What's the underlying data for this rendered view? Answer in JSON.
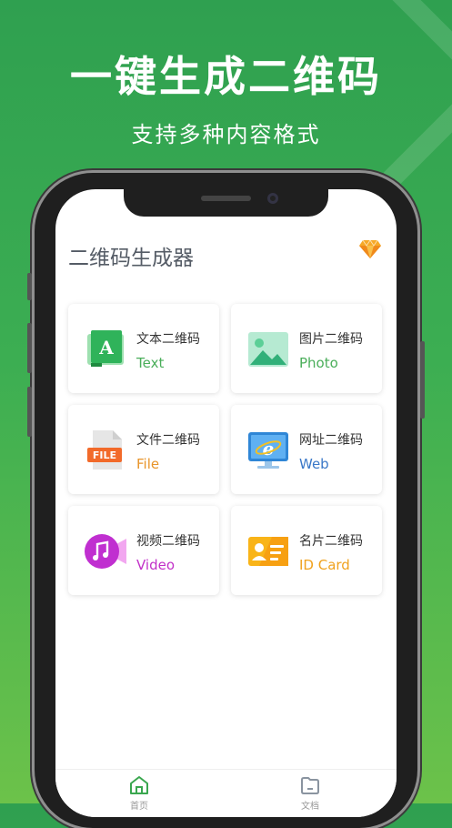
{
  "hero": {
    "title": "一键生成二维码",
    "subtitle": "支持多种内容格式"
  },
  "app": {
    "title": "二维码生成器",
    "vip_icon": "diamond-icon"
  },
  "cards": [
    {
      "name": "文本二维码",
      "en": "Text",
      "color": "#4aae5a",
      "icon": "text-book-icon"
    },
    {
      "name": "图片二维码",
      "en": "Photo",
      "color": "#4aae5a",
      "icon": "image-icon"
    },
    {
      "name": "文件二维码",
      "en": "File",
      "color": "#e8942a",
      "icon": "file-icon"
    },
    {
      "name": "网址二维码",
      "en": "Web",
      "color": "#3a78c8",
      "icon": "browser-icon"
    },
    {
      "name": "视频二维码",
      "en": "Video",
      "color": "#c231c8",
      "icon": "video-music-icon"
    },
    {
      "name": "名片二维码",
      "en": "ID Card",
      "color": "#f0a21e",
      "icon": "id-card-icon"
    }
  ],
  "tabbar": {
    "home": "首页",
    "docs": "文档"
  },
  "colors": {
    "brand_green": "#3aa74f",
    "tab_active": "#3aa74f",
    "tab_inactive": "#8a94a0"
  }
}
